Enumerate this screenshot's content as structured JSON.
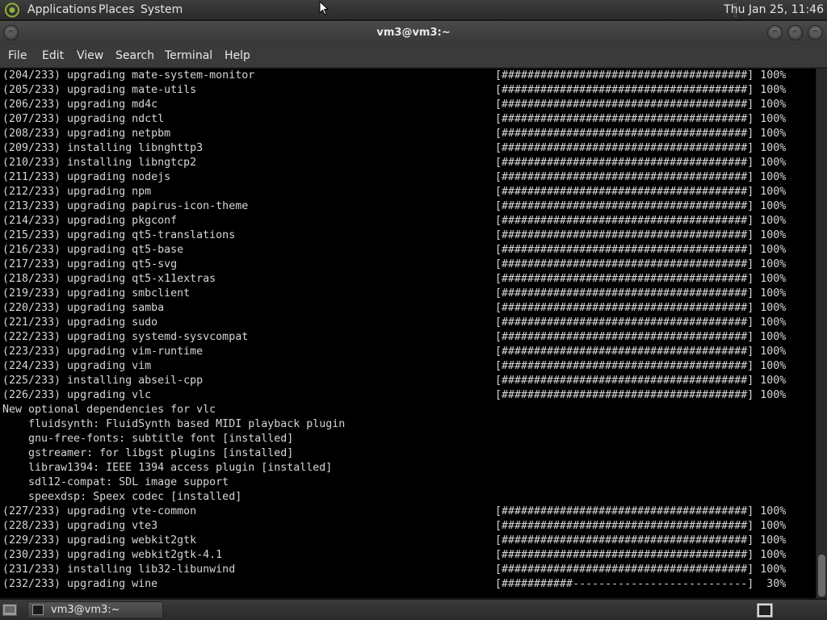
{
  "top_panel": {
    "applications": "Applications",
    "places": "Places",
    "system": "System",
    "clock": "Thu Jan 25, 11:46"
  },
  "window": {
    "title": "vm3@vm3:~"
  },
  "menu": {
    "file": "File",
    "edit": "Edit",
    "view": "View",
    "search": "Search",
    "terminal": "Terminal",
    "help": "Help"
  },
  "terminal": {
    "lines": [
      {
        "text": "(204/233) upgrading mate-system-monitor",
        "bar": "[######################################] 100%"
      },
      {
        "text": "(205/233) upgrading mate-utils",
        "bar": "[######################################] 100%"
      },
      {
        "text": "(206/233) upgrading md4c",
        "bar": "[######################################] 100%"
      },
      {
        "text": "(207/233) upgrading ndctl",
        "bar": "[######################################] 100%"
      },
      {
        "text": "(208/233) upgrading netpbm",
        "bar": "[######################################] 100%"
      },
      {
        "text": "(209/233) installing libnghttp3",
        "bar": "[######################################] 100%"
      },
      {
        "text": "(210/233) installing libngtcp2",
        "bar": "[######################################] 100%"
      },
      {
        "text": "(211/233) upgrading nodejs",
        "bar": "[######################################] 100%"
      },
      {
        "text": "(212/233) upgrading npm",
        "bar": "[######################################] 100%"
      },
      {
        "text": "(213/233) upgrading papirus-icon-theme",
        "bar": "[######################################] 100%"
      },
      {
        "text": "(214/233) upgrading pkgconf",
        "bar": "[######################################] 100%"
      },
      {
        "text": "(215/233) upgrading qt5-translations",
        "bar": "[######################################] 100%"
      },
      {
        "text": "(216/233) upgrading qt5-base",
        "bar": "[######################################] 100%"
      },
      {
        "text": "(217/233) upgrading qt5-svg",
        "bar": "[######################################] 100%"
      },
      {
        "text": "(218/233) upgrading qt5-x11extras",
        "bar": "[######################################] 100%"
      },
      {
        "text": "(219/233) upgrading smbclient",
        "bar": "[######################################] 100%"
      },
      {
        "text": "(220/233) upgrading samba",
        "bar": "[######################################] 100%"
      },
      {
        "text": "(221/233) upgrading sudo",
        "bar": "[######################################] 100%"
      },
      {
        "text": "(222/233) upgrading systemd-sysvcompat",
        "bar": "[######################################] 100%"
      },
      {
        "text": "(223/233) upgrading vim-runtime",
        "bar": "[######################################] 100%"
      },
      {
        "text": "(224/233) upgrading vim",
        "bar": "[######################################] 100%"
      },
      {
        "text": "(225/233) installing abseil-cpp",
        "bar": "[######################################] 100%"
      },
      {
        "text": "(226/233) upgrading vlc",
        "bar": "[######################################] 100%"
      },
      {
        "text": "New optional dependencies for vlc",
        "bar": ""
      },
      {
        "text": "    fluidsynth: FluidSynth based MIDI playback plugin",
        "bar": ""
      },
      {
        "text": "    gnu-free-fonts: subtitle font [installed]",
        "bar": ""
      },
      {
        "text": "    gstreamer: for libgst plugins [installed]",
        "bar": ""
      },
      {
        "text": "    libraw1394: IEEE 1394 access plugin [installed]",
        "bar": ""
      },
      {
        "text": "    sdl12-compat: SDL image support",
        "bar": ""
      },
      {
        "text": "    speexdsp: Speex codec [installed]",
        "bar": ""
      },
      {
        "text": "(227/233) upgrading vte-common",
        "bar": "[######################################] 100%"
      },
      {
        "text": "(228/233) upgrading vte3",
        "bar": "[######################################] 100%"
      },
      {
        "text": "(229/233) upgrading webkit2gtk",
        "bar": "[######################################] 100%"
      },
      {
        "text": "(230/233) upgrading webkit2gtk-4.1",
        "bar": "[######################################] 100%"
      },
      {
        "text": "(231/233) installing lib32-libunwind",
        "bar": "[######################################] 100%"
      },
      {
        "text": "(232/233) upgrading wine",
        "bar": "[###########---------------------------]  30%"
      }
    ]
  },
  "taskbar": {
    "task_label": "vm3@vm3:~"
  },
  "icons": {
    "logo": "mate-logo-icon",
    "show_desktop": "show-desktop-icon",
    "terminal": "terminal-icon"
  }
}
